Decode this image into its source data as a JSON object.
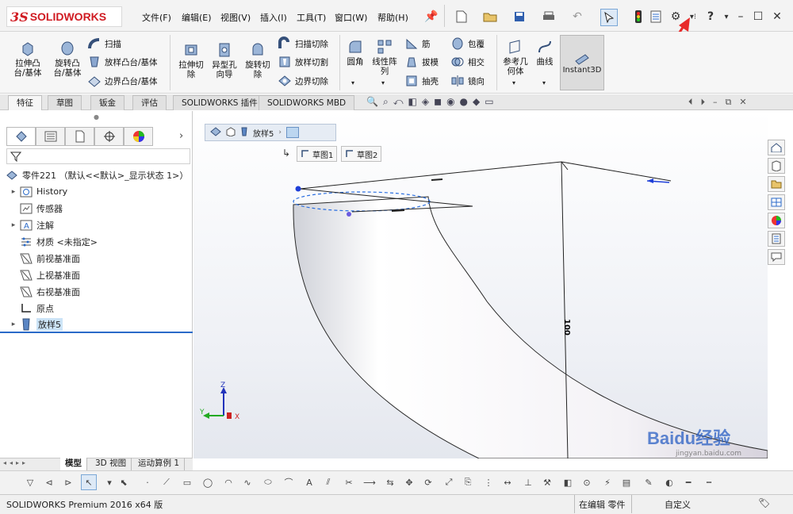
{
  "app": {
    "logo_ds": "3S",
    "logo_text": "SOLIDWORKS"
  },
  "menu": [
    {
      "label": "文件(F)"
    },
    {
      "label": "编辑(E)"
    },
    {
      "label": "视图(V)"
    },
    {
      "label": "插入(I)"
    },
    {
      "label": "工具(T)"
    },
    {
      "label": "窗口(W)"
    },
    {
      "label": "帮助(H)"
    }
  ],
  "ribbon": {
    "extrude_boss": "拉伸凸\n台/基体",
    "revolve_boss": "旋转凸\n台/基体",
    "sweep": "扫描",
    "loft_boss": "放样凸台/基体",
    "boundary_boss": "边界凸台/基体",
    "extrude_cut": "拉伸切\n除",
    "hole_wizard": "异型孔\n向导",
    "revolve_cut": "旋转切\n除",
    "swept_cut": "扫描切除",
    "lofted_cut": "放样切割",
    "boundary_cut": "边界切除",
    "fillet": "圆角",
    "linear_pattern": "线性阵\n列",
    "rib": "筋",
    "draft": "拔模",
    "shell": "抽壳",
    "wrap": "包覆",
    "intersect": "相交",
    "mirror": "镜向",
    "ref_geometry": "参考几\n何体",
    "curves": "曲线",
    "instant3d": "Instant3D"
  },
  "cmd_tabs": [
    {
      "label": "特征"
    },
    {
      "label": "草图"
    },
    {
      "label": "钣金"
    },
    {
      "label": "评估"
    },
    {
      "label": "SOLIDWORKS 插件"
    },
    {
      "label": "SOLIDWORKS MBD"
    }
  ],
  "tree": {
    "root": "零件221 （默认<<默认>_显示状态 1>）",
    "items": [
      {
        "label": "History",
        "icon": "history-icon",
        "expand": true
      },
      {
        "label": "传感器",
        "icon": "sensor-icon",
        "expand": false
      },
      {
        "label": "注解",
        "icon": "annotation-icon",
        "expand": true
      },
      {
        "label": "材质 <未指定>",
        "icon": "material-icon",
        "expand": false
      },
      {
        "label": "前视基准面",
        "icon": "plane-icon",
        "expand": false
      },
      {
        "label": "上视基准面",
        "icon": "plane-icon",
        "expand": false
      },
      {
        "label": "右视基准面",
        "icon": "plane-icon",
        "expand": false
      },
      {
        "label": "原点",
        "icon": "origin-icon",
        "expand": false
      },
      {
        "label": "放样5",
        "icon": "loft-icon",
        "expand": true
      }
    ]
  },
  "breadcrumb": {
    "feature": "放样5",
    "sketch1": "草图1",
    "sketch2": "草图2"
  },
  "viewport": {
    "dimension": "100"
  },
  "bottom_tabs": [
    {
      "label": "模型"
    },
    {
      "label": "3D 视图"
    },
    {
      "label": "运动算例 1"
    }
  ],
  "status": {
    "app": "SOLIDWORKS Premium 2016 x64 版",
    "editing": "在编辑 零件",
    "custom": "自定义"
  },
  "watermark": {
    "text": "Baidu经验",
    "url": "jingyan.baidu.com"
  },
  "colors": {
    "brand_red": "#d01b22",
    "accent_blue": "#1f3fd8",
    "selection_blue": "#cce4f7"
  }
}
